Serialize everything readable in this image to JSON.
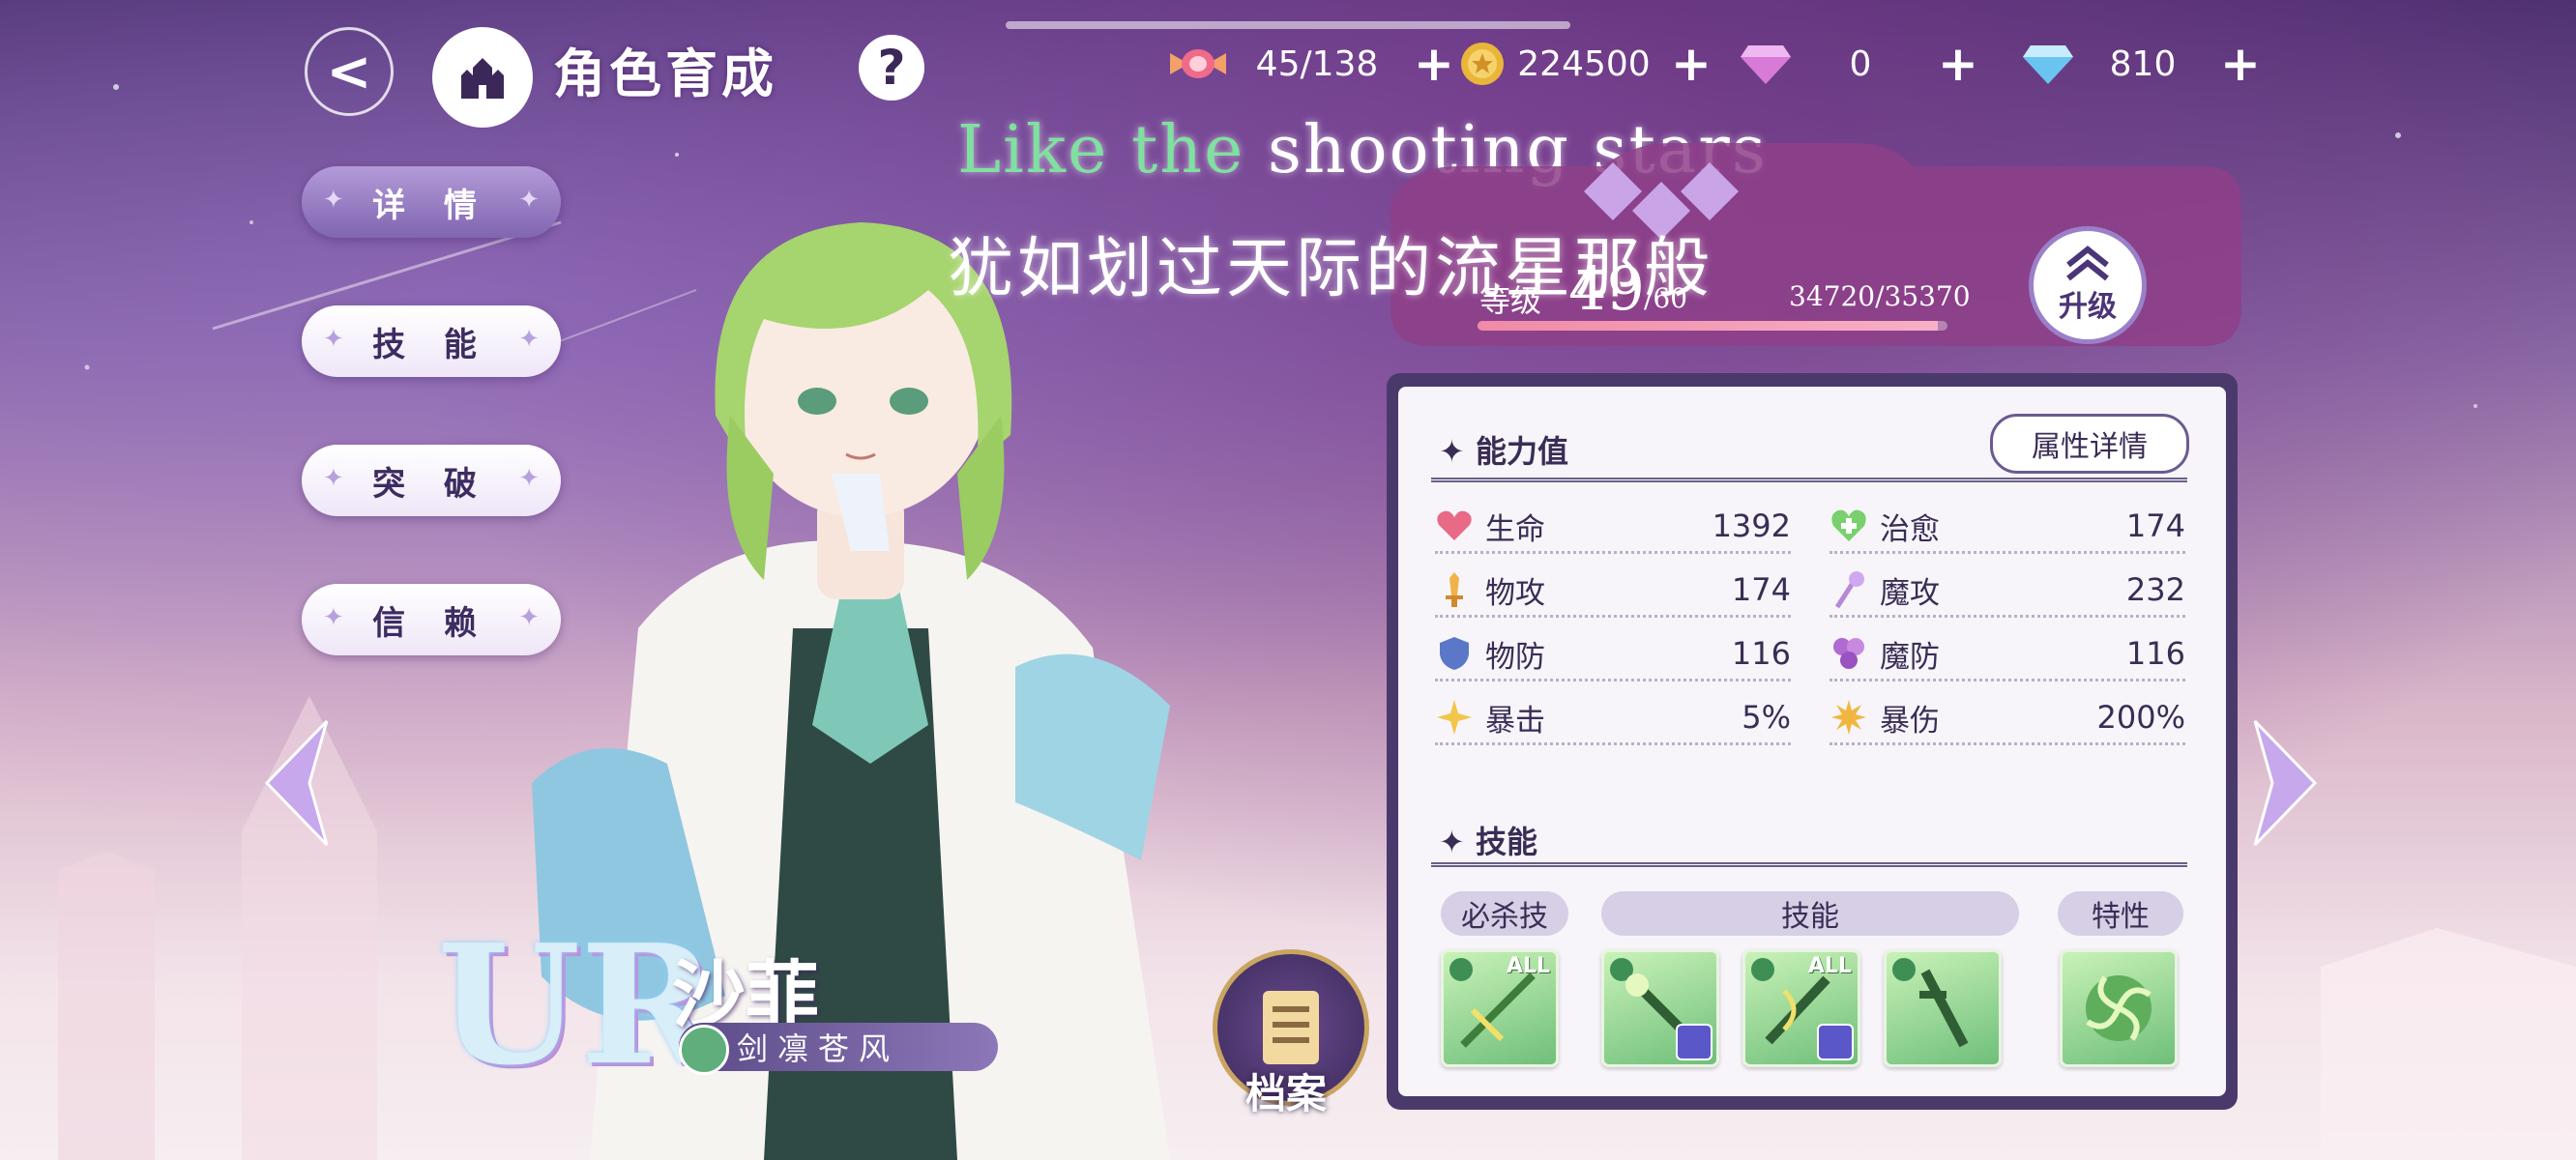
{
  "header": {
    "title": "角色育成",
    "resources": [
      {
        "icon": "candy-icon",
        "value": "45/138"
      },
      {
        "icon": "gold-coin-icon",
        "value": "224500"
      },
      {
        "icon": "pink-gem-icon",
        "value": "0"
      },
      {
        "icon": "blue-diamond-icon",
        "value": "810"
      }
    ]
  },
  "overlay_text": {
    "english_a": "Like ",
    "english_b": "the",
    "english_c": " shooting stars",
    "chinese": "犹如划过天际的流星那般"
  },
  "menu": [
    "详 情",
    "技 能",
    "突 破",
    "信 赖"
  ],
  "character": {
    "rarity": "UR",
    "name": "沙菲",
    "title": "剑凛苍风",
    "archive_label": "档案"
  },
  "level": {
    "label": "等级",
    "current": "49",
    "max": "/60",
    "exp_text": "34720/35370",
    "exp_fraction": 0.98,
    "upgrade_label": "升级"
  },
  "stats_section": {
    "title": "能力值",
    "detail_button": "属性详情",
    "stats": [
      {
        "name": "生命",
        "value": "1392",
        "icon": "heart-icon",
        "color": "#e86a86"
      },
      {
        "name": "治愈",
        "value": "174",
        "icon": "heal-plus-icon",
        "color": "#7ad06e"
      },
      {
        "name": "物攻",
        "value": "174",
        "icon": "sword-icon",
        "color": "#f0b24a"
      },
      {
        "name": "魔攻",
        "value": "232",
        "icon": "magic-staff-icon",
        "color": "#b58ad8"
      },
      {
        "name": "物防",
        "value": "116",
        "icon": "shield-icon",
        "color": "#5b78c8"
      },
      {
        "name": "魔防",
        "value": "116",
        "icon": "magic-orbs-icon",
        "color": "#b06ad0"
      },
      {
        "name": "暴击",
        "value": "5%",
        "icon": "star-burst-icon",
        "color": "#f2c64a"
      },
      {
        "name": "暴伤",
        "value": "200%",
        "icon": "sun-burst-icon",
        "color": "#f2b640"
      }
    ]
  },
  "skills_section": {
    "title": "技能",
    "tags": [
      "必杀技",
      "技能",
      "特性"
    ],
    "all_badge": "ALL"
  }
}
